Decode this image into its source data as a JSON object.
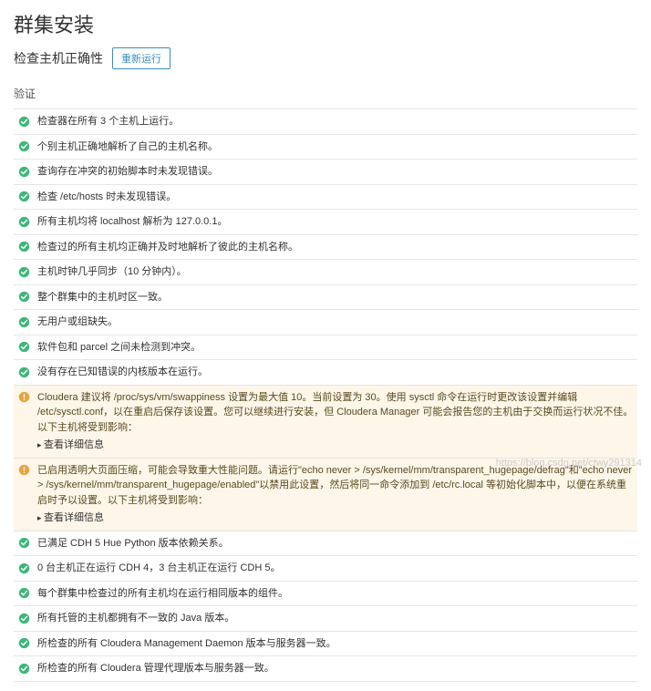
{
  "header": {
    "title": "群集安装",
    "subtitle": "检查主机正确性",
    "rerun_label": "重新运行"
  },
  "section_label": "验证",
  "detail_label": "查看详细信息",
  "items": [
    {
      "status": "ok",
      "text": "检查器在所有 3 个主机上运行。"
    },
    {
      "status": "ok",
      "text": "个别主机正确地解析了自己的主机名称。"
    },
    {
      "status": "ok",
      "text": "查询存在冲突的初始脚本时未发现错误。"
    },
    {
      "status": "ok",
      "text": "检查 /etc/hosts 时未发现错误。"
    },
    {
      "status": "ok",
      "text": "所有主机均将 localhost 解析为 127.0.0.1。"
    },
    {
      "status": "ok",
      "text": "检查过的所有主机均正确并及时地解析了彼此的主机名称。"
    },
    {
      "status": "ok",
      "text": "主机时钟几乎同步（10 分钟内）。"
    },
    {
      "status": "ok",
      "text": "整个群集中的主机时区一致。"
    },
    {
      "status": "ok",
      "text": "无用户或组缺失。"
    },
    {
      "status": "ok",
      "text": "软件包和 parcel 之间未检测到冲突。"
    },
    {
      "status": "ok",
      "text": "没有存在已知错误的内核版本在运行。"
    },
    {
      "status": "warn",
      "text": "Cloudera 建议将 /proc/sys/vm/swappiness 设置为最大值 10。当前设置为 30。使用 sysctl 命令在运行时更改该设置并编辑 /etc/sysctl.conf，以在重启后保存该设置。您可以继续进行安装，但 Cloudera Manager 可能会报告您的主机由于交换而运行状况不佳。以下主机将受到影响：",
      "has_detail": true
    },
    {
      "status": "warn",
      "text": "已启用透明大页面压缩，可能会导致重大性能问题。请运行\"echo never > /sys/kernel/mm/transparent_hugepage/defrag\"和\"echo never > /sys/kernel/mm/transparent_hugepage/enabled\"以禁用此设置，然后将同一命令添加到 /etc/rc.local 等初始化脚本中，以便在系统重启时予以设置。以下主机将受到影响：",
      "has_detail": true
    },
    {
      "status": "ok",
      "text": "已满足 CDH 5 Hue Python 版本依赖关系。"
    },
    {
      "status": "ok",
      "text": "0 台主机正在运行 CDH 4，3 台主机正在运行 CDH 5。"
    },
    {
      "status": "ok",
      "text": "每个群集中检查过的所有主机均在运行相同版本的组件。"
    },
    {
      "status": "ok",
      "text": "所有托管的主机都拥有不一致的 Java 版本。"
    },
    {
      "status": "ok",
      "text": "所检查的所有 Cloudera Management Daemon 版本与服务器一致。"
    },
    {
      "status": "ok",
      "text": "所检查的所有 Cloudera 管理代理版本与服务器一致。"
    }
  ],
  "watermark": "https://blog.csdn.net/ctwy291314"
}
